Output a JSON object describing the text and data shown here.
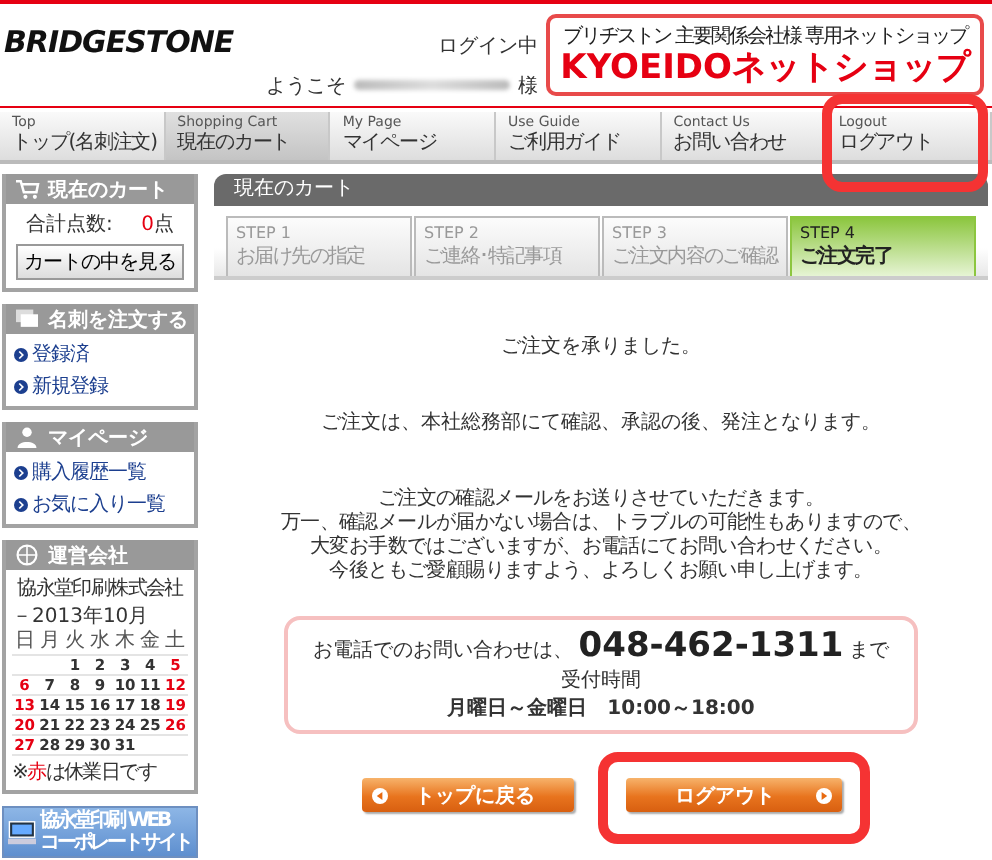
{
  "header": {
    "logo": "BRIDGESTONE",
    "login_status": "ログイン中",
    "welcome": "ようこそ",
    "honorific": "様",
    "shop_tagline": "ブリヂストン 主要関係会社様 専用ネットショップ",
    "shop_name": "KYOEIDOネットショップ"
  },
  "nav": [
    {
      "en": "Top",
      "label": "トップ(名刺注文)",
      "selected": false,
      "highlighted": false
    },
    {
      "en": "Shopping Cart",
      "label": "現在のカート",
      "selected": true,
      "highlighted": false
    },
    {
      "en": "My Page",
      "label": "マイページ",
      "selected": false,
      "highlighted": false
    },
    {
      "en": "Use Guide",
      "label": "ご利用ガイド",
      "selected": false,
      "highlighted": false
    },
    {
      "en": "Contact Us",
      "label": "お問い合わせ",
      "selected": false,
      "highlighted": false
    },
    {
      "en": "Logout",
      "label": "ログアウト",
      "selected": false,
      "highlighted": true
    }
  ],
  "sidebar": {
    "cart": {
      "title": "現在のカート",
      "count_label": "合計点数:",
      "count": "0",
      "unit": "点",
      "button": "カートの中を見る"
    },
    "order": {
      "title": "名刺を注文する",
      "links": [
        "登録済",
        "新規登録"
      ]
    },
    "mypage": {
      "title": "マイページ",
      "links": [
        "購入履歴一覧",
        "お気に入り一覧"
      ]
    },
    "company": {
      "title": "運営会社",
      "name": "協永堂印刷株式会社",
      "month": "－2013年10月",
      "weekdays": [
        "日",
        "月",
        "火",
        "水",
        "木",
        "金",
        "土"
      ],
      "weeks": [
        {
          "align_right": true,
          "days": [
            {
              "day": "1",
              "closed": false
            },
            {
              "day": "2",
              "closed": false
            },
            {
              "day": "3",
              "closed": false
            },
            {
              "day": "4",
              "closed": false
            },
            {
              "day": "5",
              "closed": true
            }
          ]
        },
        {
          "align_right": false,
          "days": [
            {
              "day": "6",
              "closed": true
            },
            {
              "day": "7",
              "closed": false
            },
            {
              "day": "8",
              "closed": false
            },
            {
              "day": "9",
              "closed": false
            },
            {
              "day": "10",
              "closed": false
            },
            {
              "day": "11",
              "closed": false
            },
            {
              "day": "12",
              "closed": true
            }
          ]
        },
        {
          "align_right": false,
          "days": [
            {
              "day": "13",
              "closed": true
            },
            {
              "day": "14",
              "closed": false
            },
            {
              "day": "15",
              "closed": false
            },
            {
              "day": "16",
              "closed": false
            },
            {
              "day": "17",
              "closed": false
            },
            {
              "day": "18",
              "closed": false
            },
            {
              "day": "19",
              "closed": true
            }
          ]
        },
        {
          "align_right": false,
          "days": [
            {
              "day": "20",
              "closed": true
            },
            {
              "day": "21",
              "closed": false
            },
            {
              "day": "22",
              "closed": false
            },
            {
              "day": "23",
              "closed": false
            },
            {
              "day": "24",
              "closed": false
            },
            {
              "day": "25",
              "closed": false
            },
            {
              "day": "26",
              "closed": true
            }
          ]
        },
        {
          "align_right": false,
          "days": [
            {
              "day": "27",
              "closed": true
            },
            {
              "day": "28",
              "closed": false
            },
            {
              "day": "29",
              "closed": false
            },
            {
              "day": "30",
              "closed": false
            },
            {
              "day": "31",
              "closed": false
            }
          ]
        }
      ],
      "note_prefix": "※",
      "note_red": "赤",
      "note_rest": "は休業日です"
    },
    "banner": {
      "lines": [
        "協永堂印刷 WEB",
        "コーポレートサイト"
      ]
    }
  },
  "main": {
    "title": "現在のカート",
    "steps": [
      {
        "step": "STEP 1",
        "label": "お届け先の指定",
        "selected": false
      },
      {
        "step": "STEP 2",
        "label": "ご連絡･特記事項",
        "selected": false
      },
      {
        "step": "STEP 3",
        "label": "ご注文内容のご確認",
        "selected": false
      },
      {
        "step": "STEP 4",
        "label": "ご注文完了",
        "selected": true
      }
    ],
    "messages": [
      "ご注文を承りました。",
      "ご注文は、本社総務部にて確認、承認の後、発注となります。"
    ],
    "paragraph": [
      "ご注文の確認メールをお送りさせていただきます。",
      "万一、確認メールが届かない場合は、トラブルの可能性もありますので、",
      "大変お手数ではございますが、お電話にてお問い合わせください。",
      "今後ともご愛顧賜りますよう、よろしくお願い申し上げます。"
    ],
    "contact": {
      "lead": "お電話でのお問い合わせは、",
      "phone": "048-462-1311",
      "suffix": "まで",
      "hours_label": "受付時間",
      "hours": "月曜日～金曜日　10:00～18:00"
    },
    "buttons": [
      {
        "label": "トップに戻る",
        "kind": "back",
        "highlighted": false
      },
      {
        "label": "ログアウト",
        "kind": "forward",
        "highlighted": true
      }
    ]
  }
}
